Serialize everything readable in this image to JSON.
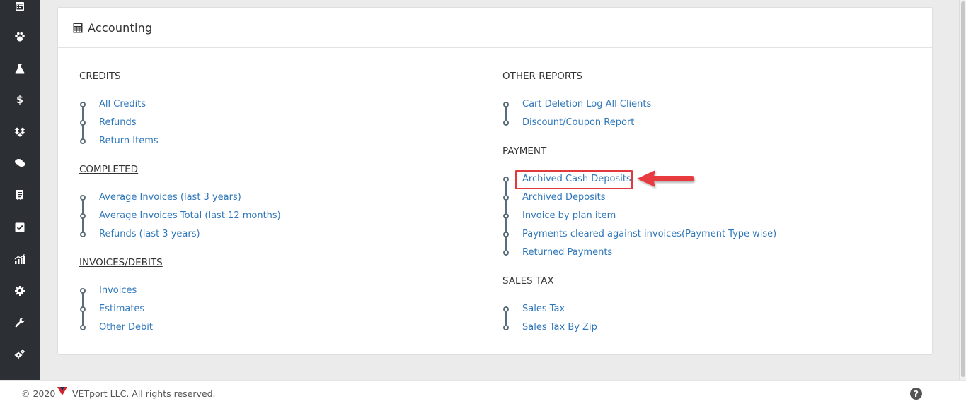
{
  "sidebar": {
    "items": [
      {
        "icon": "calendar-icon"
      },
      {
        "icon": "paw-icon"
      },
      {
        "icon": "flask-icon"
      },
      {
        "icon": "dollar-icon"
      },
      {
        "icon": "dropbox-icon"
      },
      {
        "icon": "chat-icon"
      },
      {
        "icon": "receipt-icon"
      },
      {
        "icon": "checkbox-icon"
      },
      {
        "icon": "chart-icon"
      },
      {
        "icon": "gear-icon"
      },
      {
        "icon": "wrench-icon"
      },
      {
        "icon": "gears-icon"
      }
    ]
  },
  "panel": {
    "title": "Accounting",
    "icon": "calculator-icon"
  },
  "sections": {
    "credits": {
      "title": "CREDITS",
      "items": [
        "All Credits",
        "Refunds",
        "Return Items"
      ]
    },
    "completed": {
      "title": "COMPLETED",
      "items": [
        "Average Invoices (last 3 years)",
        "Average Invoices Total (last 12 months)",
        "Refunds (last 3 years)"
      ]
    },
    "invoices_debits": {
      "title": "INVOICES/DEBITS",
      "items": [
        "Invoices",
        "Estimates",
        "Other Debit"
      ]
    },
    "other_reports": {
      "title": "OTHER REPORTS",
      "items": [
        "Cart Deletion Log All Clients",
        "Discount/Coupon Report"
      ]
    },
    "payment": {
      "title": "PAYMENT",
      "items": [
        "Archived Cash Deposits",
        "Archived Deposits",
        "Invoice by plan item",
        "Payments cleared against invoices(Payment Type wise)",
        "Returned Payments"
      ]
    },
    "sales_tax": {
      "title": "SALES TAX",
      "items": [
        "Sales Tax",
        "Sales Tax By Zip"
      ]
    }
  },
  "annotation": {
    "highlight_color": "#e0393e"
  },
  "footer": {
    "copyright": "© 2020",
    "company": "VETport LLC. All rights reserved.",
    "help_label": "?"
  },
  "colors": {
    "sidebar_bg": "#2c3034",
    "link": "#2f77ba",
    "timeline": "#5a6d78"
  }
}
